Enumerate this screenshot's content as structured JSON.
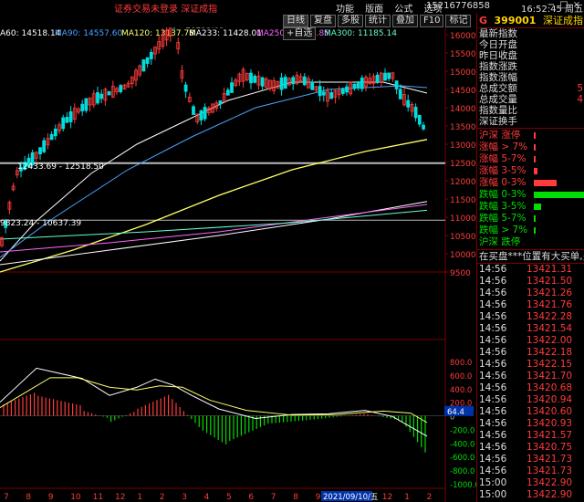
{
  "topbar": {
    "notice": "证券交易未登录  深证成指",
    "menu": [
      "功能",
      "版面",
      "公式",
      "选项"
    ],
    "phone": "15216776858",
    "clock": "16:52:45 周五",
    "win_controls": [
      "−",
      "□",
      "×"
    ]
  },
  "indicators": {
    "ma60": "A60: 14518.14",
    "ma90": "MA90: 14557.60",
    "ma120": "MA120: 13137.78",
    "ma233": "MA233: 11428.01",
    "ma250": "MA250: 11347.85",
    "ma300": "MA300: 11185.14",
    "colors": {
      "ma60": "#ffffff",
      "ma90": "#4aa3ff",
      "ma120": "#ffff66",
      "ma233": "#ffffff",
      "ma250": "#ff66ff",
      "ma300": "#66ffcc"
    }
  },
  "tabs": [
    "日线",
    "复盘",
    "多股",
    "统计",
    "叠加",
    "F10",
    "标记",
    "+自选"
  ],
  "chart_labels": {
    "high": "16293.09",
    "range1": "12433.69 - 12518.50",
    "range2": "9823.24 - 10637.39",
    "date_marker": "2021/09/10/五",
    "macd_value": "64.4"
  },
  "price_axis": [
    "16000",
    "15500",
    "15000",
    "14500",
    "14000",
    "13500",
    "13000",
    "12500",
    "12000",
    "11500",
    "11000",
    "10500",
    "10000",
    "9500"
  ],
  "macd_axis": [
    "800.0",
    "600.0",
    "400.0",
    "200.0",
    "0",
    "-200.0",
    "-400.0",
    "-600.0",
    "-800.0",
    "-1000.0"
  ],
  "x_axis": [
    "7",
    "8",
    "9",
    "10",
    "11",
    "12",
    "1",
    "2",
    "3",
    "4",
    "5",
    "6",
    "7",
    "8",
    "9",
    "10",
    "11",
    "12",
    "1",
    "2"
  ],
  "panel": {
    "g": "G",
    "code": "399001",
    "name": "深证成指",
    "stats": [
      {
        "label": "最新指数",
        "value": ""
      },
      {
        "label": "今日开盘",
        "value": ""
      },
      {
        "label": "昨日收盘",
        "value": ""
      },
      {
        "label": "指数涨跌",
        "value": ""
      },
      {
        "label": "指数涨幅",
        "value": ""
      },
      {
        "label": "总成交额",
        "value": "5"
      },
      {
        "label": "总成交量",
        "value": "4"
      },
      {
        "label": "指数量比",
        "value": ""
      },
      {
        "label": "深证换手",
        "value": ""
      }
    ],
    "distribution": [
      {
        "label": "沪深 涨停",
        "color": "#ff3b3b",
        "fill": 0.02
      },
      {
        "label": "涨幅 > 7%",
        "color": "#ff3b3b",
        "fill": 0.02
      },
      {
        "label": "涨幅 5-7%",
        "color": "#ff3b3b",
        "fill": 0.04
      },
      {
        "label": "涨幅 3-5%",
        "color": "#ff3b3b",
        "fill": 0.08
      },
      {
        "label": "涨幅 0-3%",
        "color": "#ff3b3b",
        "fill": 0.45
      },
      {
        "label": "跌幅 0-3%",
        "color": "#00dd00",
        "fill": 1.0
      },
      {
        "label": "跌幅 3-5%",
        "color": "#00dd00",
        "fill": 0.15
      },
      {
        "label": "跌幅 5-7%",
        "color": "#00dd00",
        "fill": 0.02
      },
      {
        "label": "跌幅 > 7%",
        "color": "#00dd00",
        "fill": 0.02
      },
      {
        "label": "沪深 跌停",
        "color": "#00dd00",
        "fill": 0.0
      }
    ],
    "ticker": "在买盘***位置有大买单,多",
    "trades": [
      {
        "time": "14:56",
        "price": "13421.31"
      },
      {
        "time": "14:56",
        "price": "13421.50"
      },
      {
        "time": "14:56",
        "price": "13421.26"
      },
      {
        "time": "14:56",
        "price": "13421.76"
      },
      {
        "time": "14:56",
        "price": "13422.28"
      },
      {
        "time": "14:56",
        "price": "13421.54"
      },
      {
        "time": "14:56",
        "price": "13422.00"
      },
      {
        "time": "14:56",
        "price": "13422.18"
      },
      {
        "time": "14:56",
        "price": "13422.15"
      },
      {
        "time": "14:56",
        "price": "13421.70"
      },
      {
        "time": "14:56",
        "price": "13420.68"
      },
      {
        "time": "14:56",
        "price": "13420.94"
      },
      {
        "time": "14:56",
        "price": "13420.60"
      },
      {
        "time": "14:56",
        "price": "13420.93"
      },
      {
        "time": "14:56",
        "price": "13421.57"
      },
      {
        "time": "14:56",
        "price": "13420.75"
      },
      {
        "time": "14:56",
        "price": "13421.73"
      },
      {
        "time": "14:56",
        "price": "13421.73"
      },
      {
        "time": "15:00",
        "price": "13422.90"
      },
      {
        "time": "15:00",
        "price": "13422.90"
      }
    ]
  }
}
